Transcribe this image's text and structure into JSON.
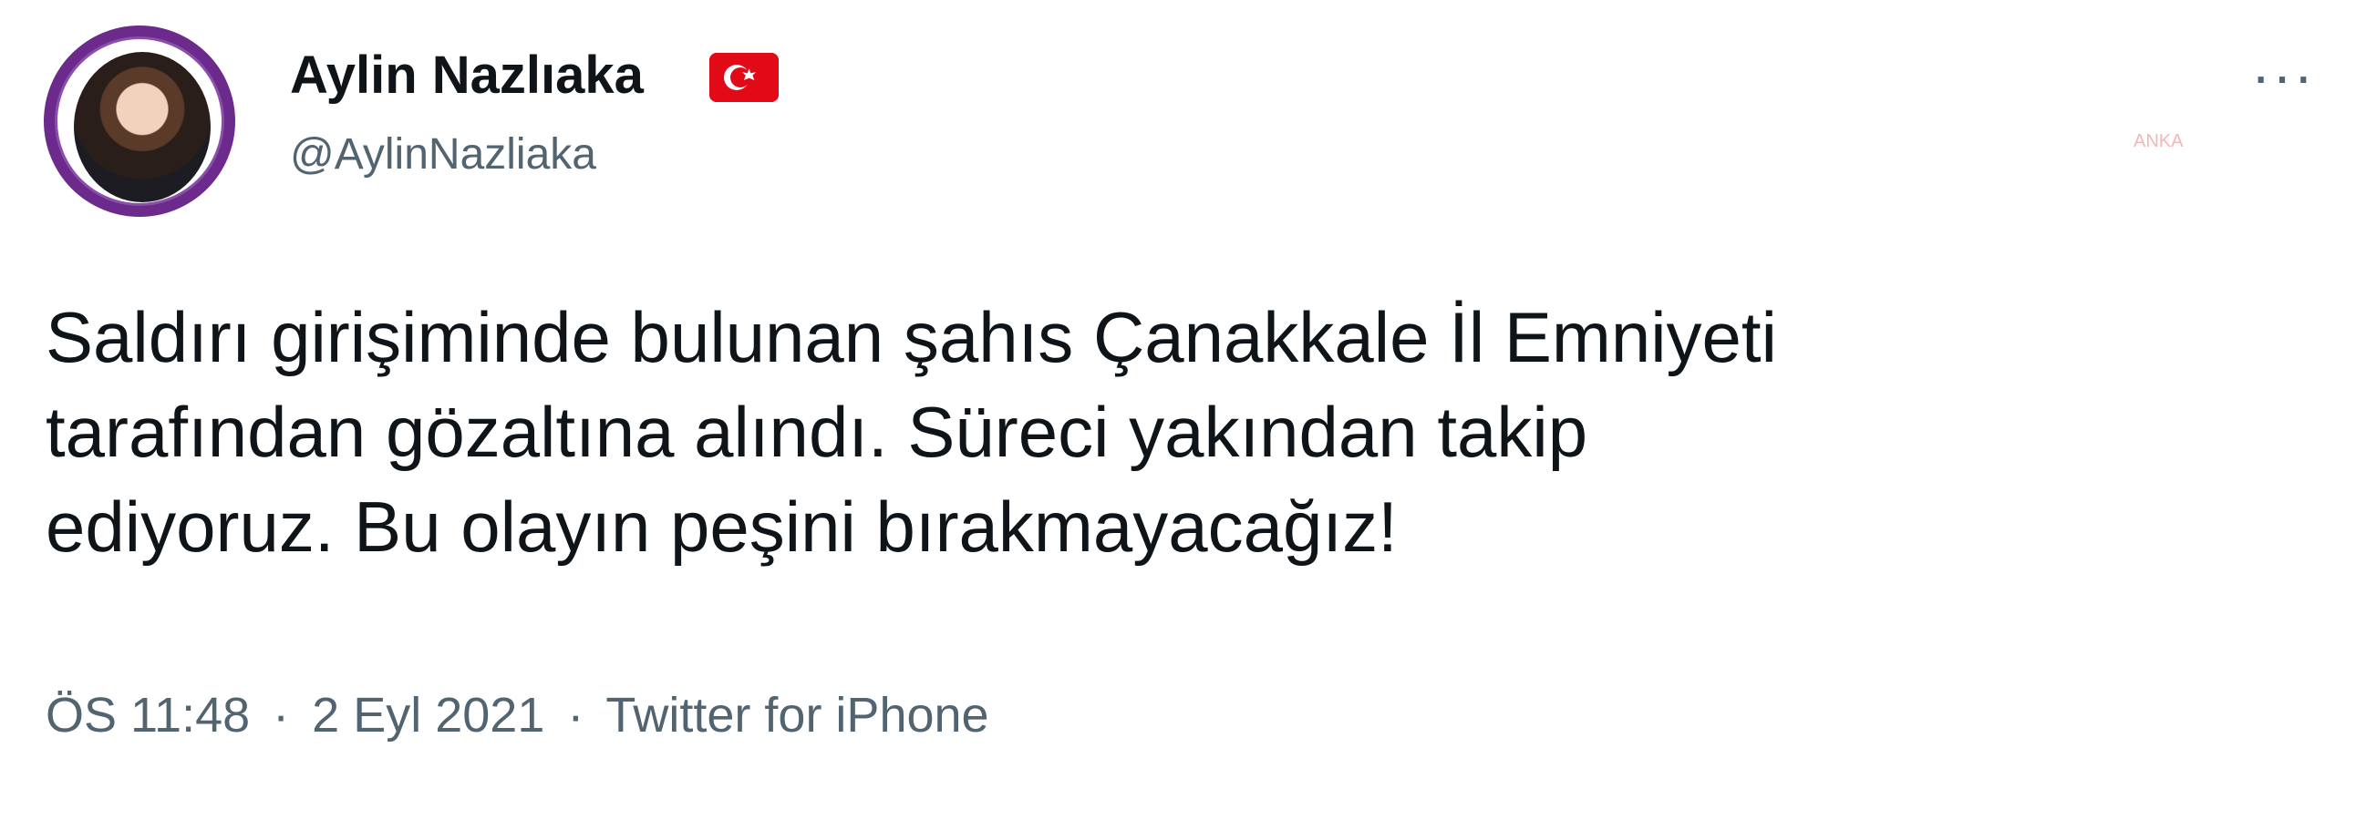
{
  "tweet": {
    "author": {
      "name": "Aylin Nazlıaka",
      "handle": "@AylinNazliaka",
      "flag_icon": "turkey-flag-icon",
      "avatar_icon": "avatar"
    },
    "more_icon": "more-options-icon",
    "watermark": "anka",
    "text_lines": [
      "Saldırı girişiminde bulunan şahıs Çanakkale İl Emniyeti",
      "tarafından gözaltına alındı. Süreci yakından takip",
      "ediyoruz. Bu olayın peşini bırakmayacağız!"
    ],
    "meta": {
      "time": "ÖS 11:48",
      "separator": "·",
      "date": "2 Eyl 2021",
      "source": "Twitter for iPhone"
    }
  },
  "colors": {
    "text": "#0f1419",
    "secondary": "#536471",
    "avatar_border": "#6b2a8c",
    "flag_red": "#e30a17"
  }
}
